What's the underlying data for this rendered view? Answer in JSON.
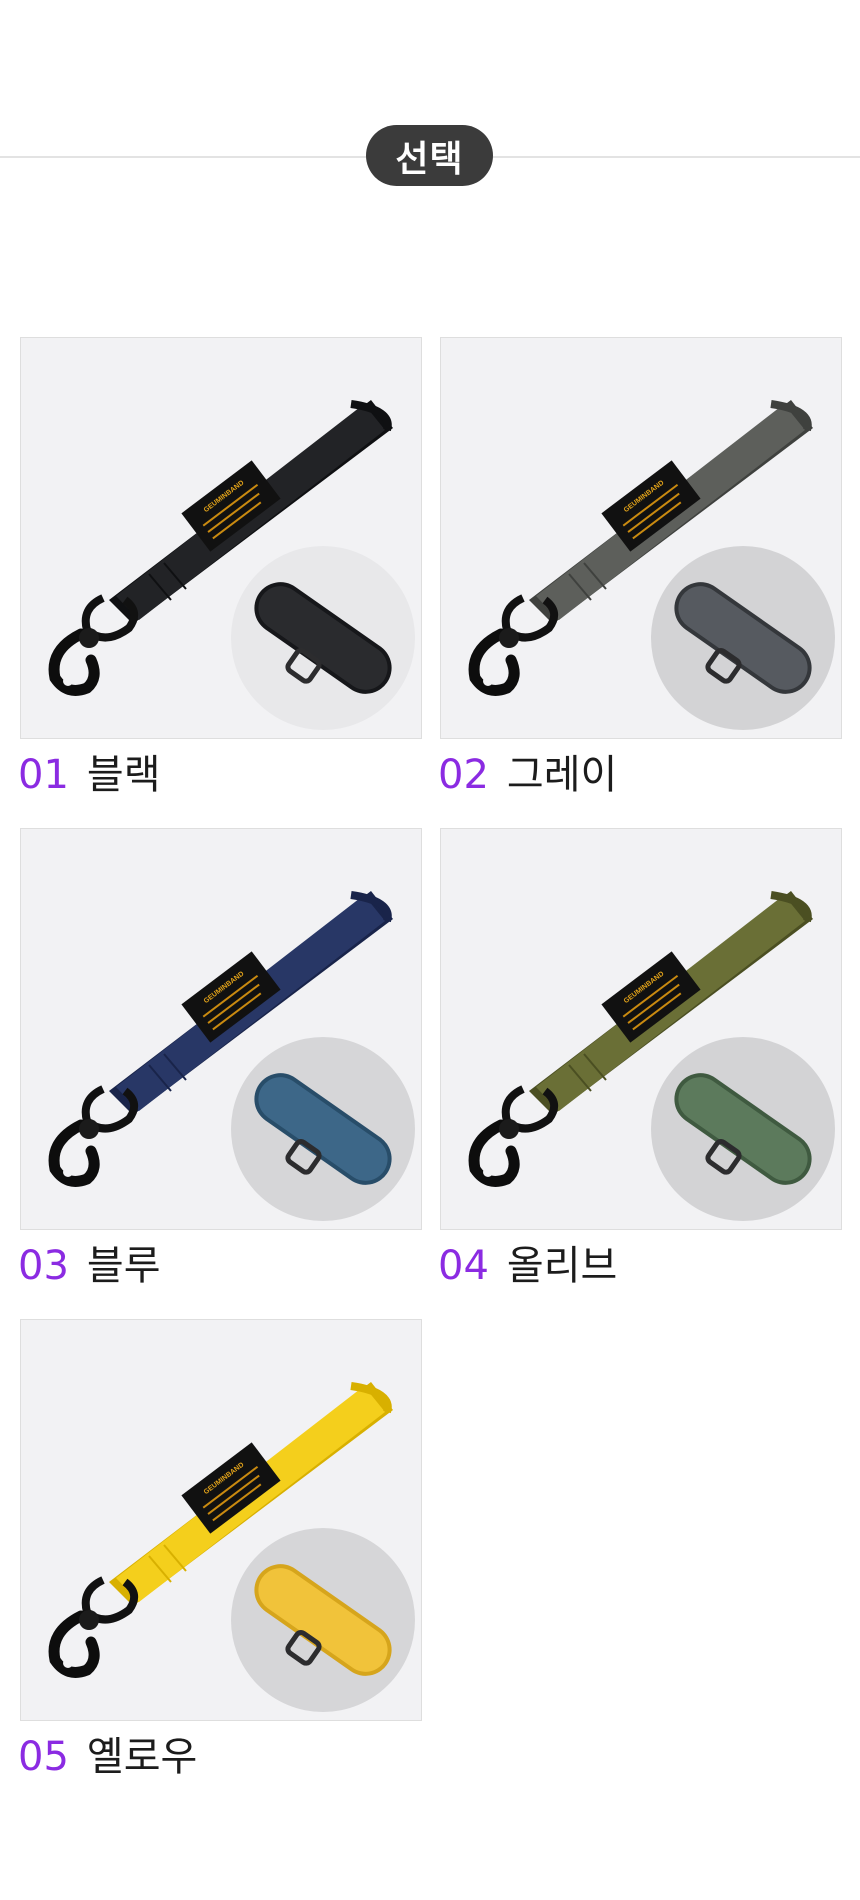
{
  "header": {
    "badge": "선택"
  },
  "items": [
    {
      "num": "01",
      "name": "블랙",
      "strap": "#222326",
      "strap_edge": "#0f1012",
      "tab": "#2a2b2e",
      "tab_edge": "#16171a",
      "circle": "#e8e8ea"
    },
    {
      "num": "02",
      "name": "그레이",
      "strap": "#5d5f5b",
      "strap_edge": "#3f413e",
      "tab": "#565a60",
      "tab_edge": "#34373b",
      "circle": "#d3d3d5"
    },
    {
      "num": "03",
      "name": "블루",
      "strap": "#283766",
      "strap_edge": "#19244a",
      "tab": "#3d6788",
      "tab_edge": "#284d69",
      "circle": "#d6d6d8"
    },
    {
      "num": "04",
      "name": "올리브",
      "strap": "#6a6f36",
      "strap_edge": "#4b4f22",
      "tab": "#5c7a5c",
      "tab_edge": "#3f5a40",
      "circle": "#d3d3d5"
    },
    {
      "num": "05",
      "name": "옐로우",
      "strap": "#f4cf1c",
      "strap_edge": "#d8b000",
      "tab": "#f1c33a",
      "tab_edge": "#d6a51c",
      "circle": "#d6d6d8"
    }
  ],
  "label_text": "GEUMINBAND"
}
